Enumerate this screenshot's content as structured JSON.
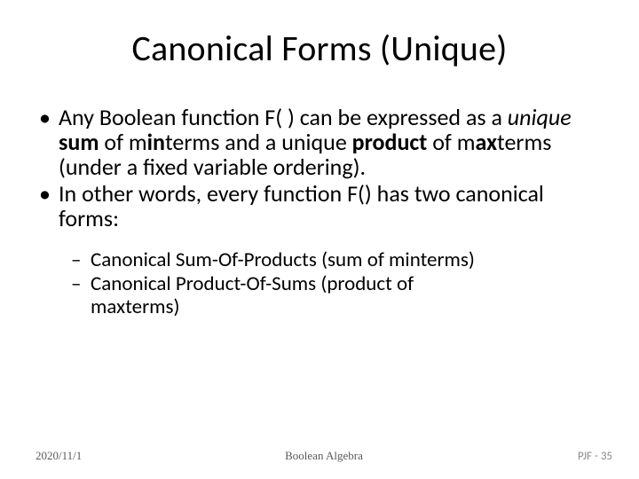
{
  "title": "Canonical Forms (Unique)",
  "bullets": {
    "b1a_pre": "Any Boolean function F( ) can be expressed as a ",
    "b1a_em": "unique",
    "b1a_mid1": " ",
    "b1a_s1": "sum",
    "b1a_mid2": " of m",
    "b1a_s2": "in",
    "b1a_mid3": "terms and a unique ",
    "b1a_s3": "product",
    "b1a_mid4": " of m",
    "b1a_s4": "ax",
    "b1a_post": "terms (under a fixed variable ordering).",
    "b1b": "In other words, every function F() has two canonical forms:",
    "b2a": "Canonical Sum-Of-Products  (sum of minterms)",
    "b2b_line1": "Canonical Product-Of-Sums       (product of",
    "b2b_line2": "maxterms)"
  },
  "footer": {
    "date": "2020/11/1",
    "center": "Boolean Algebra",
    "page": "PJF - 35"
  }
}
